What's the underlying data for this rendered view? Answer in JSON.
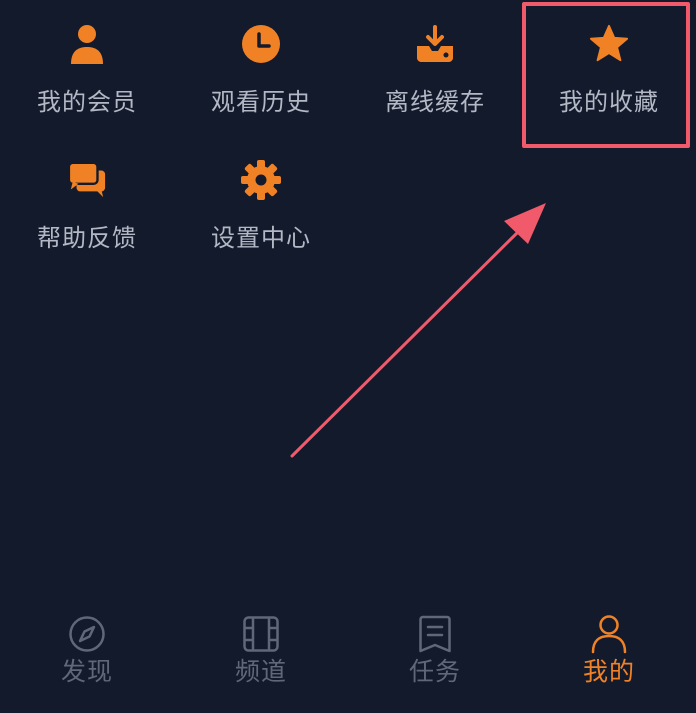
{
  "colors": {
    "background": "#131a2c",
    "accent": "#f08225",
    "label": "#b3b8c4",
    "tab_inactive": "#5f6779",
    "annotation": "#f05a6a"
  },
  "menu": {
    "items": [
      {
        "label": "我的会员",
        "icon": "member-user-icon"
      },
      {
        "label": "观看历史",
        "icon": "history-clock-icon"
      },
      {
        "label": "离线缓存",
        "icon": "offline-download-icon"
      },
      {
        "label": "我的收藏",
        "icon": "favorites-star-icon"
      },
      {
        "label": "帮助反馈",
        "icon": "feedback-chat-icon"
      },
      {
        "label": "设置中心",
        "icon": "settings-gear-icon"
      }
    ]
  },
  "tabbar": {
    "tabs": [
      {
        "label": "发现",
        "icon": "compass-icon",
        "active": false
      },
      {
        "label": "频道",
        "icon": "film-icon",
        "active": false
      },
      {
        "label": "任务",
        "icon": "task-list-icon",
        "active": false
      },
      {
        "label": "我的",
        "icon": "profile-icon",
        "active": true
      }
    ]
  }
}
